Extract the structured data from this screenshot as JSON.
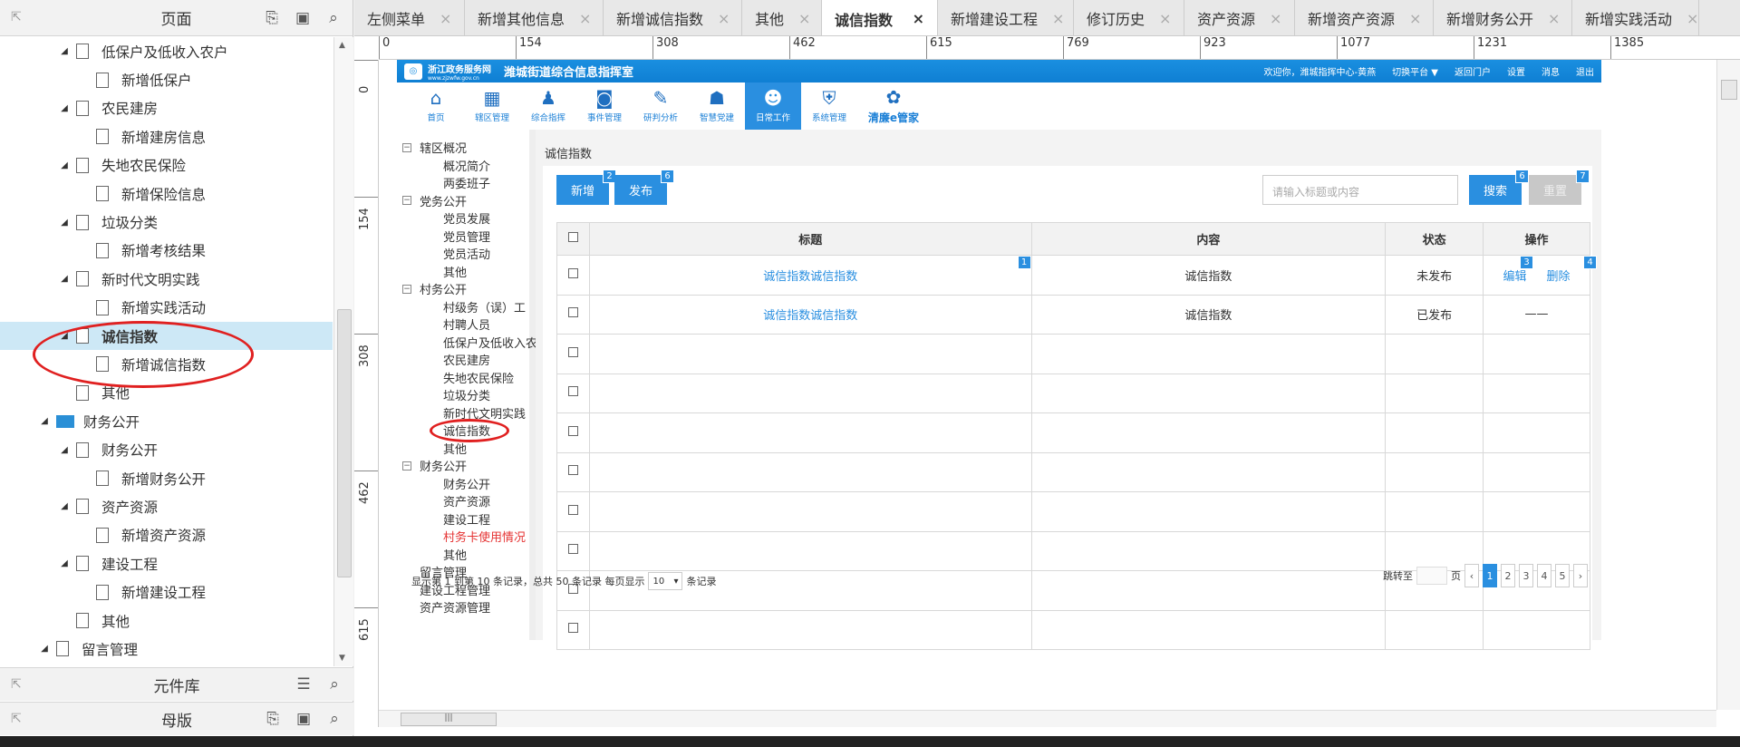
{
  "left_panel": {
    "title": "页面",
    "tree": [
      {
        "label": "低保户及低收入农户",
        "level": 1,
        "toggle": "◢"
      },
      {
        "label": "新增低保户",
        "level": 2,
        "toggle": ""
      },
      {
        "label": "农民建房",
        "level": 1,
        "toggle": "◢"
      },
      {
        "label": "新增建房信息",
        "level": 2,
        "toggle": ""
      },
      {
        "label": "失地农民保险",
        "level": 1,
        "toggle": "◢"
      },
      {
        "label": "新增保险信息",
        "level": 2,
        "toggle": ""
      },
      {
        "label": "垃圾分类",
        "level": 1,
        "toggle": "◢"
      },
      {
        "label": "新增考核结果",
        "level": 2,
        "toggle": ""
      },
      {
        "label": "新时代文明实践",
        "level": 1,
        "toggle": "◢"
      },
      {
        "label": "新增实践活动",
        "level": 2,
        "toggle": ""
      },
      {
        "label": "诚信指数",
        "level": 1,
        "toggle": "◢",
        "selected": true
      },
      {
        "label": "新增诚信指数",
        "level": 2,
        "toggle": ""
      },
      {
        "label": "其他",
        "level": 1,
        "toggle": ""
      },
      {
        "label": "财务公开",
        "level": 0,
        "toggle": "◢",
        "folder": true
      },
      {
        "label": "财务公开",
        "level": 1,
        "toggle": "◢"
      },
      {
        "label": "新增财务公开",
        "level": 2,
        "toggle": ""
      },
      {
        "label": "资产资源",
        "level": 1,
        "toggle": "◢"
      },
      {
        "label": "新增资产资源",
        "level": 2,
        "toggle": ""
      },
      {
        "label": "建设工程",
        "level": 1,
        "toggle": "◢"
      },
      {
        "label": "新增建设工程",
        "level": 2,
        "toggle": ""
      },
      {
        "label": "其他",
        "level": 1,
        "toggle": ""
      },
      {
        "label": "留言管理",
        "level": 0,
        "toggle": "◢"
      }
    ],
    "components_title": "元件库",
    "masters_title": "母版"
  },
  "tabs": [
    {
      "label": "左侧菜单",
      "active": false
    },
    {
      "label": "新增其他信息",
      "active": false
    },
    {
      "label": "新增诚信指数",
      "active": false
    },
    {
      "label": "其他",
      "active": false
    },
    {
      "label": "诚信指数",
      "active": true
    },
    {
      "label": "新增建设工程",
      "active": false
    },
    {
      "label": "修订历史",
      "active": false
    },
    {
      "label": "资产资源",
      "active": false
    },
    {
      "label": "新增资产资源",
      "active": false
    },
    {
      "label": "新增财务公开",
      "active": false
    },
    {
      "label": "新增实践活动",
      "active": false
    }
  ],
  "ruler": {
    "top_ticks": [
      "0",
      "154",
      "308",
      "462",
      "615",
      "769",
      "923",
      "1077",
      "1231",
      "1385"
    ],
    "left_ticks": [
      "0",
      "154",
      "308",
      "462",
      "615"
    ]
  },
  "app": {
    "logo_text": "浙江政务服务网",
    "logo_sub": "www.zjzwfw.gov.cn",
    "system_title": "潍城街道综合信息指挥室",
    "top_right": [
      "欢迎你，潍城指挥中心-黄燕",
      "切换平台 ▼",
      "返回门户",
      "设置",
      "消息",
      "退出"
    ],
    "nav": [
      {
        "label": "首页",
        "icon": "⌂"
      },
      {
        "label": "辖区管理",
        "icon": "▦"
      },
      {
        "label": "综合指挥",
        "icon": "♟"
      },
      {
        "label": "事件管理",
        "icon": "◙"
      },
      {
        "label": "研判分析",
        "icon": "✎"
      },
      {
        "label": "智慧党建",
        "icon": "☗"
      },
      {
        "label": "日常工作",
        "icon": "☻",
        "active": true
      },
      {
        "label": "系统管理",
        "icon": "⛨"
      },
      {
        "label": "清廉e管家",
        "icon": "✿",
        "big": true
      }
    ],
    "side": [
      {
        "type": "group",
        "label": "辖区概况"
      },
      {
        "type": "item",
        "label": "概况简介"
      },
      {
        "type": "item",
        "label": "两委班子"
      },
      {
        "type": "group",
        "label": "党务公开"
      },
      {
        "type": "item",
        "label": "党员发展"
      },
      {
        "type": "item",
        "label": "党员管理"
      },
      {
        "type": "item",
        "label": "党员活动"
      },
      {
        "type": "item",
        "label": "其他"
      },
      {
        "type": "group",
        "label": "村务公开"
      },
      {
        "type": "item",
        "label": "村级务（误）工"
      },
      {
        "type": "item",
        "label": "村聘人员"
      },
      {
        "type": "item",
        "label": "低保户及低收入农户"
      },
      {
        "type": "item",
        "label": "农民建房"
      },
      {
        "type": "item",
        "label": "失地农民保险"
      },
      {
        "type": "item",
        "label": "垃圾分类"
      },
      {
        "type": "item",
        "label": "新时代文明实践"
      },
      {
        "type": "item",
        "label": "诚信指数",
        "highlight": true
      },
      {
        "type": "item",
        "label": "其他"
      },
      {
        "type": "group",
        "label": "财务公开"
      },
      {
        "type": "item",
        "label": "财务公开"
      },
      {
        "type": "item",
        "label": "资产资源"
      },
      {
        "type": "item",
        "label": "建设工程"
      },
      {
        "type": "item",
        "label": "村务卡使用情况",
        "red": true
      },
      {
        "type": "item",
        "label": "其他"
      },
      {
        "type": "root",
        "label": "留言管理"
      },
      {
        "type": "root",
        "label": "建设工程管理"
      },
      {
        "type": "root",
        "label": "资产资源管理"
      }
    ],
    "page_title": "诚信指数",
    "buttons": {
      "add": "新增",
      "publish": "发布",
      "search": "搜索",
      "reset": "重置"
    },
    "badges": {
      "add": "2",
      "publish": "6",
      "search": "6",
      "reset": "7",
      "title": "1",
      "edit": "3",
      "delete": "4"
    },
    "search_placeholder": "请输入标题或内容",
    "table": {
      "headers": [
        "标题",
        "内容",
        "状态",
        "操作"
      ],
      "rows": [
        {
          "title": "诚信指数诚信指数",
          "content": "诚信指数",
          "status": "未发布",
          "edit": "编辑",
          "delete": "删除"
        },
        {
          "title": "诚信指数诚信指数",
          "content": "诚信指数",
          "status": "已发布",
          "op": "——"
        }
      ],
      "empty_rows": 8
    },
    "pagination": {
      "summary": "显示第 1 到第 10 条记录，总共 50 条记录 每页显示",
      "per_page": "10",
      "per_page_suffix": "条记录",
      "jump_label": "跳转至",
      "page_suffix": "页",
      "pages": [
        "1",
        "2",
        "3",
        "4",
        "5"
      ],
      "current": "1",
      "prev": "‹",
      "next": "›"
    }
  },
  "colors": {
    "accent": "#2a8fe0",
    "annotation_red": "#e02020",
    "selected_row": "#cde8f6"
  }
}
